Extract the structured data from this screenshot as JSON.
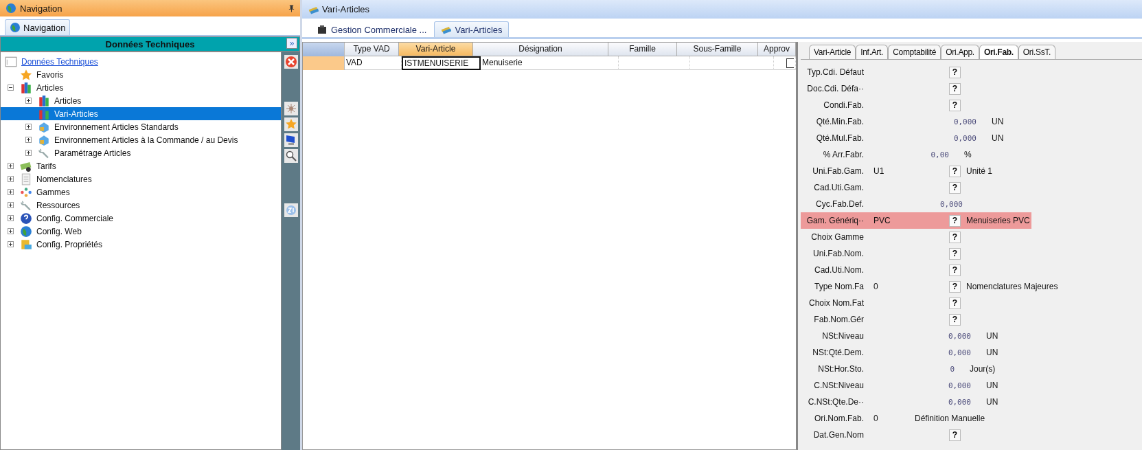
{
  "nav_panel": {
    "title": "Navigation",
    "tab": {
      "label": "Navigation",
      "selected": true
    },
    "section_title": "Données Techniques",
    "collapse_glyph": "»"
  },
  "tree": [
    {
      "label": "Données Techniques",
      "kind": "link",
      "selected": false
    },
    {
      "label": "Favoris",
      "kind": "leaf",
      "selected": false
    },
    {
      "label": "Articles",
      "kind": "node",
      "expanded": true,
      "selected": false,
      "children": [
        {
          "label": "Articles",
          "kind": "node",
          "expanded": false,
          "selected": false
        },
        {
          "label": "Vari-Articles",
          "kind": "leaf",
          "selected": true
        },
        {
          "label": "Environnement Articles Standards",
          "kind": "node",
          "expanded": false,
          "selected": false
        },
        {
          "label": "Environnement Articles à la Commande / au Devis",
          "kind": "node",
          "expanded": false,
          "selected": false
        },
        {
          "label": "Paramétrage Articles",
          "kind": "node",
          "expanded": false,
          "selected": false
        }
      ]
    },
    {
      "label": "Tarifs",
      "kind": "node",
      "expanded": false,
      "selected": false
    },
    {
      "label": "Nomenclatures",
      "kind": "node",
      "expanded": false,
      "selected": false
    },
    {
      "label": "Gammes",
      "kind": "node",
      "expanded": false,
      "selected": false
    },
    {
      "label": "Ressources",
      "kind": "node",
      "expanded": false,
      "selected": false
    },
    {
      "label": "Config. Commerciale",
      "kind": "node",
      "expanded": false,
      "selected": false
    },
    {
      "label": "Config. Web",
      "kind": "node",
      "expanded": false,
      "selected": false
    },
    {
      "label": "Config. Propriétés",
      "kind": "node",
      "expanded": false,
      "selected": false
    }
  ],
  "document": {
    "title": "Vari-Articles",
    "tabs": [
      {
        "label": "Gestion Commerciale ...",
        "selected": false
      },
      {
        "label": "Vari-Articles",
        "selected": true
      }
    ]
  },
  "table": {
    "columns": [
      {
        "label": "Type VAD",
        "selected": false
      },
      {
        "label": "Vari-Article",
        "selected": true
      },
      {
        "label": "Désignation",
        "selected": false
      },
      {
        "label": "Famille",
        "selected": false
      },
      {
        "label": "Sous-Famille",
        "selected": false
      },
      {
        "label": "Approv",
        "selected": false
      }
    ],
    "rows": [
      {
        "cells": [
          {
            "text": "VAD",
            "current": false
          },
          {
            "text": "ISTMENUISERIE",
            "current": true
          },
          {
            "text": "Menuiserie",
            "current": false
          },
          {
            "text": "",
            "current": false
          },
          {
            "text": "",
            "current": false
          }
        ],
        "approv_checked": false
      }
    ]
  },
  "detail": {
    "tabs": [
      {
        "label": "Vari-Article",
        "selected": false
      },
      {
        "label": "Inf.Art.",
        "selected": false
      },
      {
        "label": "Comptabilité",
        "selected": false
      },
      {
        "label": "Ori.App.",
        "selected": false
      },
      {
        "label": "Ori.Fab.",
        "selected": true
      },
      {
        "label": "Ori.SsT.",
        "selected": false
      }
    ],
    "fields": [
      {
        "kind": "lookup",
        "label": "Typ.Cdi. Défaut",
        "help_glyph": "?",
        "selected": false
      },
      {
        "kind": "lookup",
        "label": "Doc.Cdi. Défa··",
        "help_glyph": "?",
        "selected": false
      },
      {
        "kind": "lookup",
        "label": "Condi.Fab.",
        "help_glyph": "?",
        "selected": false
      },
      {
        "kind": "number",
        "label": "Qté.Min.Fab.",
        "number": "0,000",
        "unit": "UN",
        "selected": false
      },
      {
        "kind": "number",
        "label": "Qté.Mul.Fab.",
        "number": "0,000",
        "unit": "UN",
        "selected": false
      },
      {
        "kind": "short",
        "label": "% Arr.Fabr.",
        "number": "0,00",
        "unit": "%",
        "selected": false
      },
      {
        "kind": "lookup",
        "label": "Uni.Fab.Gam.",
        "value": "U1",
        "help_glyph": "?",
        "description": "Unité 1",
        "selected": false
      },
      {
        "kind": "lookup",
        "label": "Cad.Uti.Gam.",
        "help_glyph": "?",
        "selected": false
      },
      {
        "kind": "mid",
        "label": "Cyc.Fab.Def.",
        "number": "0,000",
        "selected": false
      },
      {
        "kind": "lookup",
        "label": "Gam. Génériq··",
        "value": "PVC",
        "help_glyph": "?",
        "description": "Menuiseries PVC",
        "selected": true
      },
      {
        "kind": "lookup",
        "label": "Choix Gamme",
        "help_glyph": "?",
        "selected": false
      },
      {
        "kind": "lookup",
        "label": "Uni.Fab.Nom.",
        "help_glyph": "?",
        "selected": false
      },
      {
        "kind": "lookup",
        "label": "Cad.Uti.Nom.",
        "help_glyph": "?",
        "selected": false
      },
      {
        "kind": "lookup",
        "label": "Type Nom.Fa",
        "value": "0",
        "help_glyph": "?",
        "description": "Nomenclatures Majeures",
        "selected": false
      },
      {
        "kind": "lookup",
        "label": "Choix Nom.Fat",
        "help_glyph": "?",
        "selected": false
      },
      {
        "kind": "lookup",
        "label": "Fab.Nom.Gér",
        "help_glyph": "?",
        "selected": false
      },
      {
        "kind": "number2",
        "label": "NSt:Niveau",
        "number": "0,000",
        "unit": "UN",
        "selected": false
      },
      {
        "kind": "number2",
        "label": "NSt:Qté.Dem.",
        "number": "0,000",
        "unit": "UN",
        "selected": false
      },
      {
        "kind": "days",
        "label": "NSt:Hor.Sto.",
        "number": "0",
        "unit": "Jour(s)",
        "selected": false
      },
      {
        "kind": "number2",
        "label": "C.NSt:Niveau",
        "number": "0,000",
        "unit": "UN",
        "selected": false
      },
      {
        "kind": "number2",
        "label": "C.NSt:Qte.De··",
        "number": "0,000",
        "unit": "UN",
        "selected": false
      },
      {
        "kind": "text",
        "label": "Ori.Nom.Fab.",
        "value": "0",
        "description": "Définition Manuelle",
        "selected": false
      },
      {
        "kind": "lookup",
        "label": "Dat.Gen.Nom",
        "help_glyph": "?",
        "selected": false
      }
    ]
  }
}
